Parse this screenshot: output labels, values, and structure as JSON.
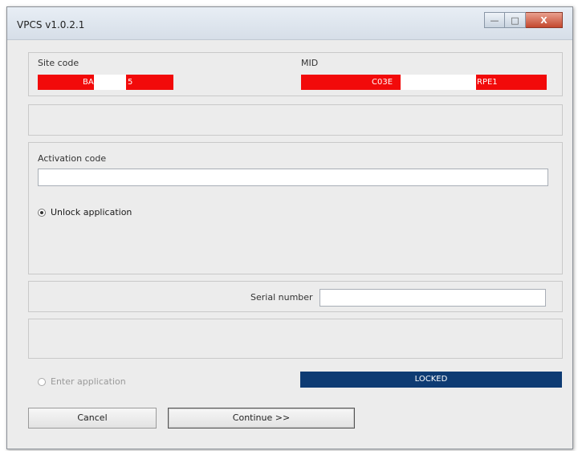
{
  "window": {
    "title": "VPCS v1.0.2.1",
    "controls": {
      "minimize": "—",
      "maximize": "□",
      "close": "X"
    }
  },
  "site": {
    "label": "Site code",
    "value_left": "BA",
    "value_right": "5"
  },
  "mid": {
    "label": "MID",
    "value_left": "C03E",
    "value_right": "RPE1"
  },
  "activation": {
    "label": "Activation code",
    "value": ""
  },
  "unlock_radio": {
    "label": "Unlock application",
    "checked": true
  },
  "serial": {
    "label": "Serial number",
    "value": ""
  },
  "enter_radio": {
    "label": "Enter application",
    "checked": false,
    "enabled": false
  },
  "status": {
    "text": "LOCKED",
    "color": "#0e3b73"
  },
  "buttons": {
    "cancel": "Cancel",
    "continue": "Continue >>"
  },
  "colors": {
    "redacted_field": "#f20a0a"
  }
}
